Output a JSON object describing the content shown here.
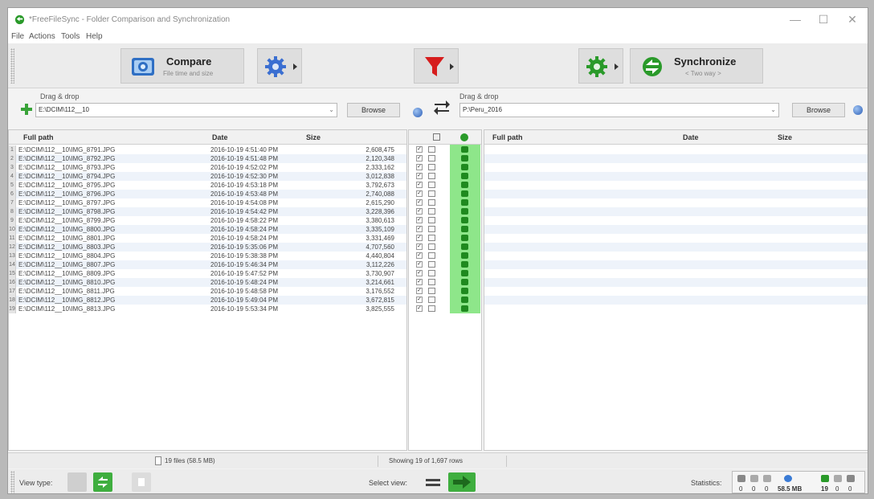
{
  "window": {
    "title": "*FreeFileSync - Folder Comparison and Synchronization",
    "minimize_glyph": "—",
    "maximize_glyph": "☐",
    "close_glyph": "✕"
  },
  "menu": [
    "File",
    "Actions",
    "Tools",
    "Help"
  ],
  "toolbar": {
    "compare_label": "Compare",
    "compare_sub": "File time and size",
    "sync_label": "Synchronize",
    "sync_sub": "< Two way >"
  },
  "left_folder": {
    "dragdrop_label": "Drag & drop",
    "path": "E:\\DCIM\\112__10",
    "browse_label": "Browse"
  },
  "right_folder": {
    "dragdrop_label": "Drag & drop",
    "path": "P:\\Peru_2016",
    "browse_label": "Browse"
  },
  "left_grid": {
    "headers": [
      "Full path",
      "Date",
      "Size"
    ],
    "rows": [
      [
        "E:\\DCIM\\112__10\\IMG_8791.JPG",
        "2016-10-19  4:51:40 PM",
        "2,608,475"
      ],
      [
        "E:\\DCIM\\112__10\\IMG_8792.JPG",
        "2016-10-19  4:51:48 PM",
        "2,120,348"
      ],
      [
        "E:\\DCIM\\112__10\\IMG_8793.JPG",
        "2016-10-19  4:52:02 PM",
        "2,333,162"
      ],
      [
        "E:\\DCIM\\112__10\\IMG_8794.JPG",
        "2016-10-19  4:52:30 PM",
        "3,012,838"
      ],
      [
        "E:\\DCIM\\112__10\\IMG_8795.JPG",
        "2016-10-19  4:53:18 PM",
        "3,792,673"
      ],
      [
        "E:\\DCIM\\112__10\\IMG_8796.JPG",
        "2016-10-19  4:53:48 PM",
        "2,740,088"
      ],
      [
        "E:\\DCIM\\112__10\\IMG_8797.JPG",
        "2016-10-19  4:54:08 PM",
        "2,615,290"
      ],
      [
        "E:\\DCIM\\112__10\\IMG_8798.JPG",
        "2016-10-19  4:54:42 PM",
        "3,228,396"
      ],
      [
        "E:\\DCIM\\112__10\\IMG_8799.JPG",
        "2016-10-19  4:58:22 PM",
        "3,380,613"
      ],
      [
        "E:\\DCIM\\112__10\\IMG_8800.JPG",
        "2016-10-19  4:58:24 PM",
        "3,335,109"
      ],
      [
        "E:\\DCIM\\112__10\\IMG_8801.JPG",
        "2016-10-19  4:58:24 PM",
        "3,331,469"
      ],
      [
        "E:\\DCIM\\112__10\\IMG_8803.JPG",
        "2016-10-19  5:35:06 PM",
        "4,707,560"
      ],
      [
        "E:\\DCIM\\112__10\\IMG_8804.JPG",
        "2016-10-19  5:38:38 PM",
        "4,440,804"
      ],
      [
        "E:\\DCIM\\112__10\\IMG_8807.JPG",
        "2016-10-19  5:46:34 PM",
        "3,112,226"
      ],
      [
        "E:\\DCIM\\112__10\\IMG_8809.JPG",
        "2016-10-19  5:47:52 PM",
        "3,730,907"
      ],
      [
        "E:\\DCIM\\112__10\\IMG_8810.JPG",
        "2016-10-19  5:48:24 PM",
        "3,214,661"
      ],
      [
        "E:\\DCIM\\112__10\\IMG_8811.JPG",
        "2016-10-19  5:48:58 PM",
        "3,176,552"
      ],
      [
        "E:\\DCIM\\112__10\\IMG_8812.JPG",
        "2016-10-19  5:49:04 PM",
        "3,672,815"
      ],
      [
        "E:\\DCIM\\112__10\\IMG_8813.JPG",
        "2016-10-19  5:53:34 PM",
        "3,825,555"
      ]
    ]
  },
  "right_grid": {
    "headers": [
      "Full path",
      "Date",
      "Size"
    ]
  },
  "status": {
    "left_summary": "19 files (58.5 MB)",
    "center_summary": "Showing 19 of 1,697 rows"
  },
  "bottom": {
    "view_type_label": "View type:",
    "select_view_label": "Select view:",
    "statistics_label": "Statistics:",
    "stats": [
      "0",
      "0",
      "0",
      "58.5 MB",
      "19",
      "0",
      "0"
    ]
  },
  "colors": {
    "sync_column": "#8ee68a",
    "sync_arrow": "#1f8a1f",
    "filter_red": "#d61d1d",
    "gear_blue": "#3b6fd1",
    "gear_green": "#2a9a2a"
  }
}
